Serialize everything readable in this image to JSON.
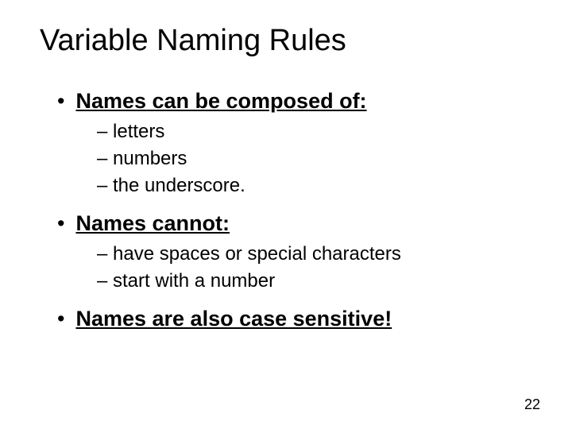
{
  "title": "Variable Naming Rules",
  "bullet1": "Names can be composed of:",
  "sub1a": "– letters",
  "sub1b": "– numbers",
  "sub1c": "– the underscore.",
  "bullet2": "Names cannot:",
  "sub2a": "– have spaces or special characters",
  "sub2b": "– start with a number",
  "bullet3": "Names are also case sensitive!",
  "pageNumber": "22"
}
